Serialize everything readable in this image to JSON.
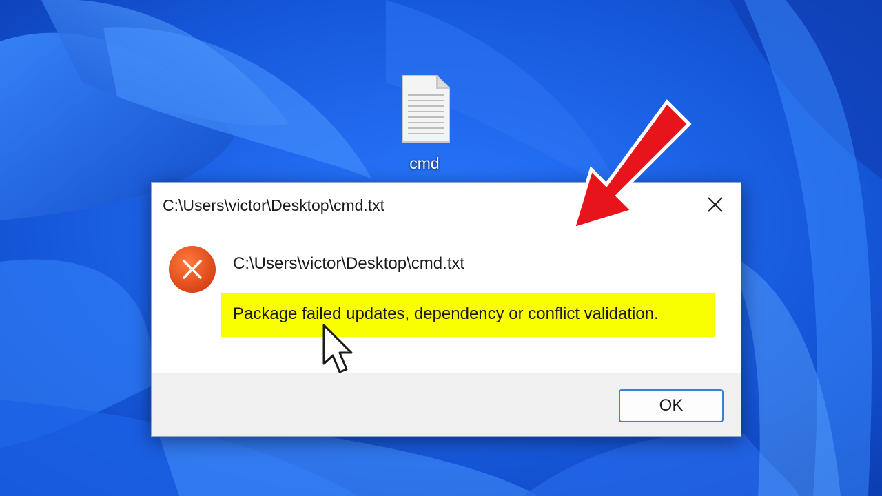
{
  "desktop": {
    "icon_label": "cmd",
    "wallpaper_color": "#1a5fe0"
  },
  "dialog": {
    "title": "C:\\Users\\victor\\Desktop\\cmd.txt",
    "close_icon": "close-icon",
    "message_path": "C:\\Users\\victor\\Desktop\\cmd.txt",
    "message_error": "Package failed updates, dependency or conflict validation.",
    "ok_label": "OK",
    "error_icon": "error-icon",
    "error_icon_color": "#e5531e",
    "highlight_color": "#f9ff00"
  },
  "annotation": {
    "arrow_color": "#e8141c",
    "arrow_icon": "red-arrow-icon",
    "cursor_icon": "mouse-pointer-icon"
  }
}
